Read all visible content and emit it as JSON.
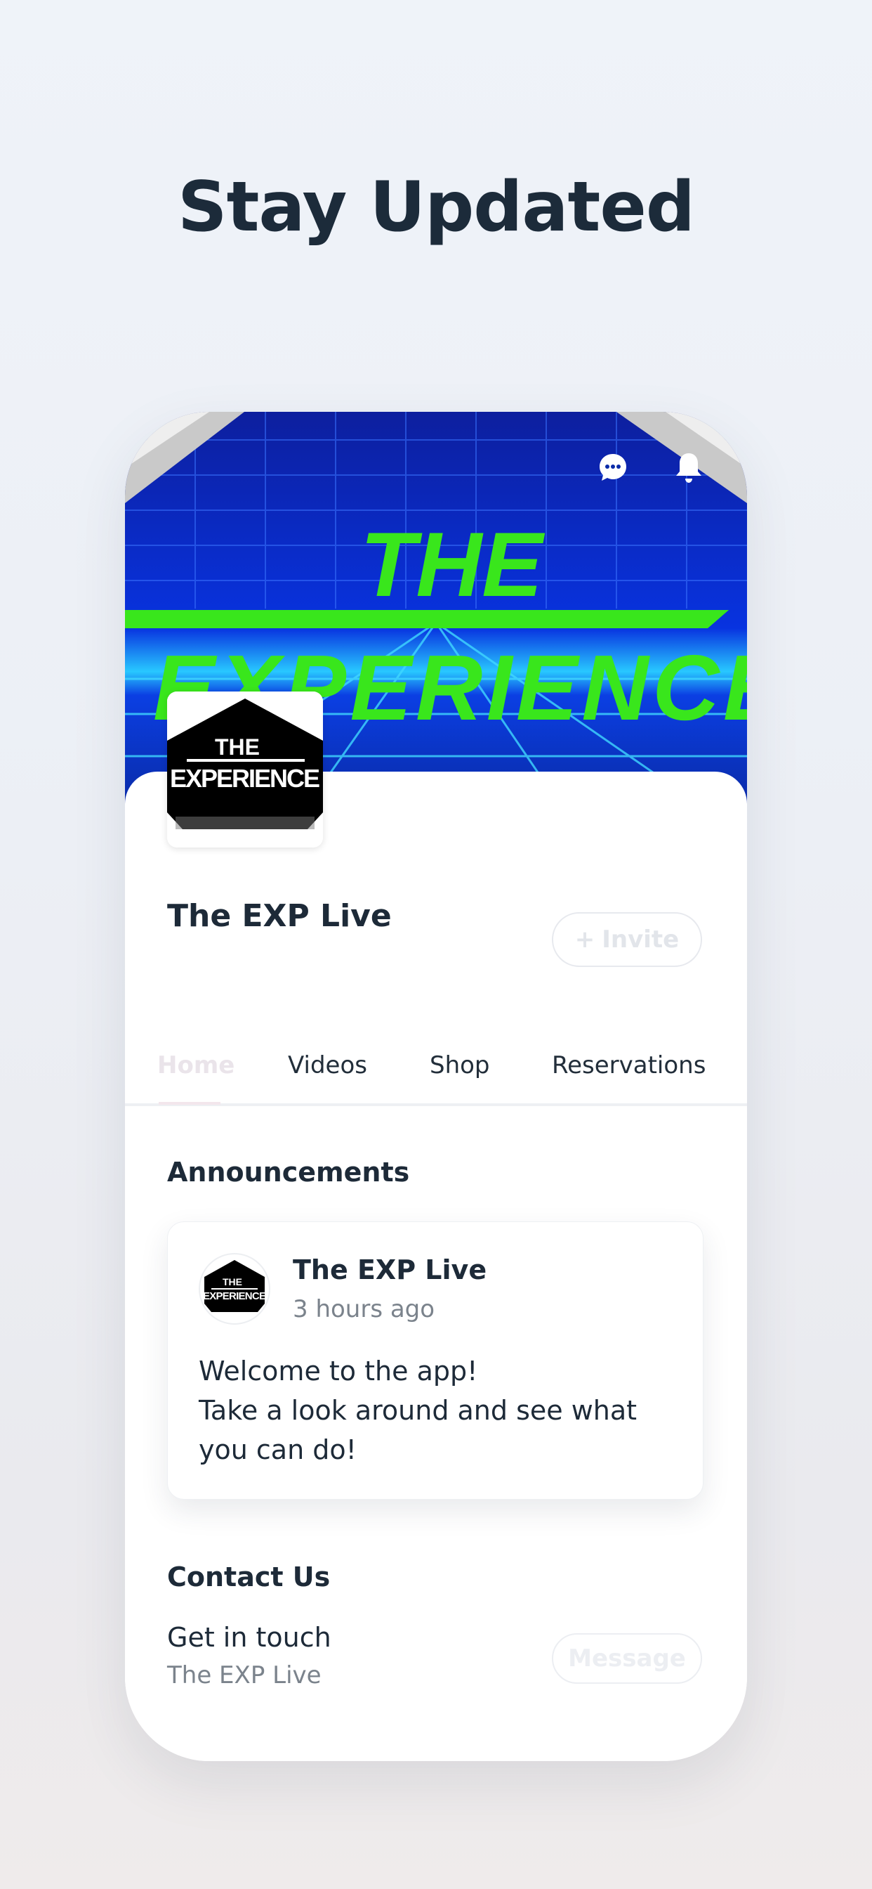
{
  "headline": "Stay Updated",
  "cover": {
    "title_line1": "THE",
    "title_line2": "EXPERIENCE",
    "icons": [
      "chat-icon",
      "bell-icon"
    ]
  },
  "logo": {
    "line1": "THE",
    "line2": "EXPERIENCE"
  },
  "site": {
    "name": "The EXP Live",
    "invite_label": "Invite"
  },
  "tabs": [
    {
      "label": "Home",
      "active": true
    },
    {
      "label": "Videos",
      "active": false
    },
    {
      "label": "Shop",
      "active": false
    },
    {
      "label": "Reservations",
      "active": false
    }
  ],
  "announcements": {
    "title": "Announcements",
    "post": {
      "author": "The EXP Live",
      "time": "3 hours ago",
      "line1": "Welcome to the app!",
      "line2": "Take a look around and see what you can do!"
    }
  },
  "contact": {
    "title": "Contact Us",
    "label": "Get in touch",
    "name": "The EXP Live",
    "button": "Message"
  },
  "colors": {
    "neon_green": "#39e61c",
    "cover_blue": "#0a32d8",
    "text_dark": "#1d2a38",
    "muted": "#7b838c"
  }
}
